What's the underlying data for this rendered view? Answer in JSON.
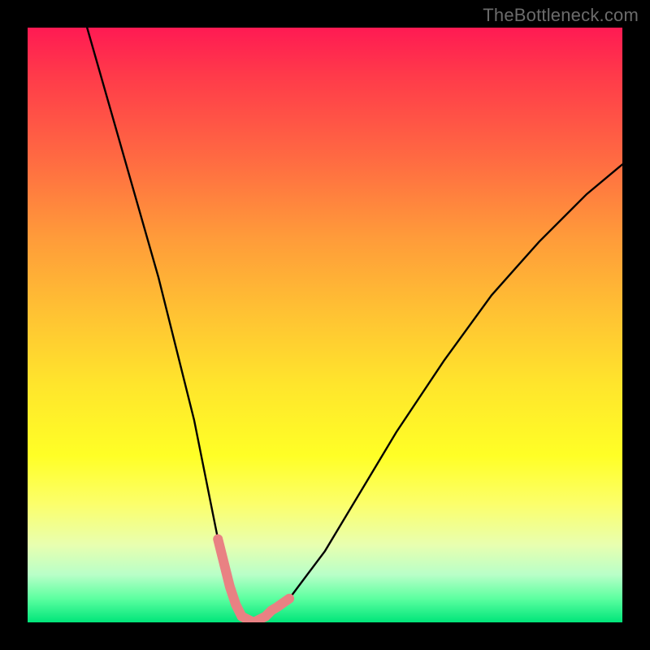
{
  "watermark": "TheBottleneck.com",
  "colors": {
    "frame": "#000000",
    "curve": "#000000",
    "highlight": "#e98183",
    "green": "#00e57a"
  },
  "chart_data": {
    "type": "line",
    "title": "",
    "xlabel": "",
    "ylabel": "",
    "xlim": [
      0,
      100
    ],
    "ylim": [
      0,
      100
    ],
    "grid": false,
    "legend": false,
    "series": [
      {
        "name": "bottleneck-curve",
        "x": [
          10,
          14,
          18,
          22,
          26,
          28,
          30,
          32,
          34,
          36,
          38,
          40,
          44,
          50,
          56,
          62,
          70,
          78,
          86,
          94,
          100
        ],
        "y": [
          100,
          86,
          72,
          58,
          42,
          34,
          24,
          14,
          6,
          1,
          0,
          1,
          4,
          12,
          22,
          32,
          44,
          55,
          64,
          72,
          77
        ]
      }
    ],
    "highlight_segments": [
      {
        "name": "left-knee",
        "x": [
          32,
          33,
          34,
          35,
          36
        ],
        "y": [
          14,
          10,
          6,
          3,
          1
        ]
      },
      {
        "name": "floor-and-right-knee",
        "x": [
          36,
          38,
          40,
          41,
          42,
          43,
          44
        ],
        "y": [
          1,
          0,
          1,
          2,
          2.6,
          3.3,
          4
        ]
      }
    ],
    "annotations": []
  }
}
